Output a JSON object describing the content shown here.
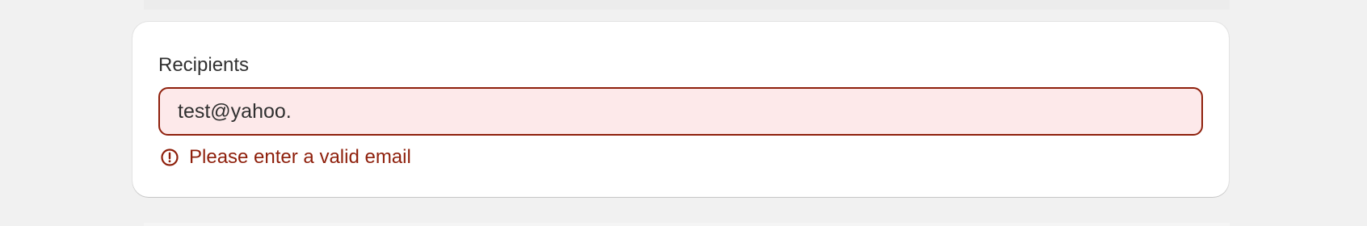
{
  "recipients": {
    "label": "Recipients",
    "value": "test@yahoo.",
    "error_message": "Please enter a valid email"
  },
  "colors": {
    "background": "#f1f1f1",
    "card": "#ffffff",
    "error": "#8e1f0b",
    "input_error_fill": "#fde9ea",
    "text": "#303030"
  },
  "icons": {
    "error": "alert-circle-icon"
  }
}
